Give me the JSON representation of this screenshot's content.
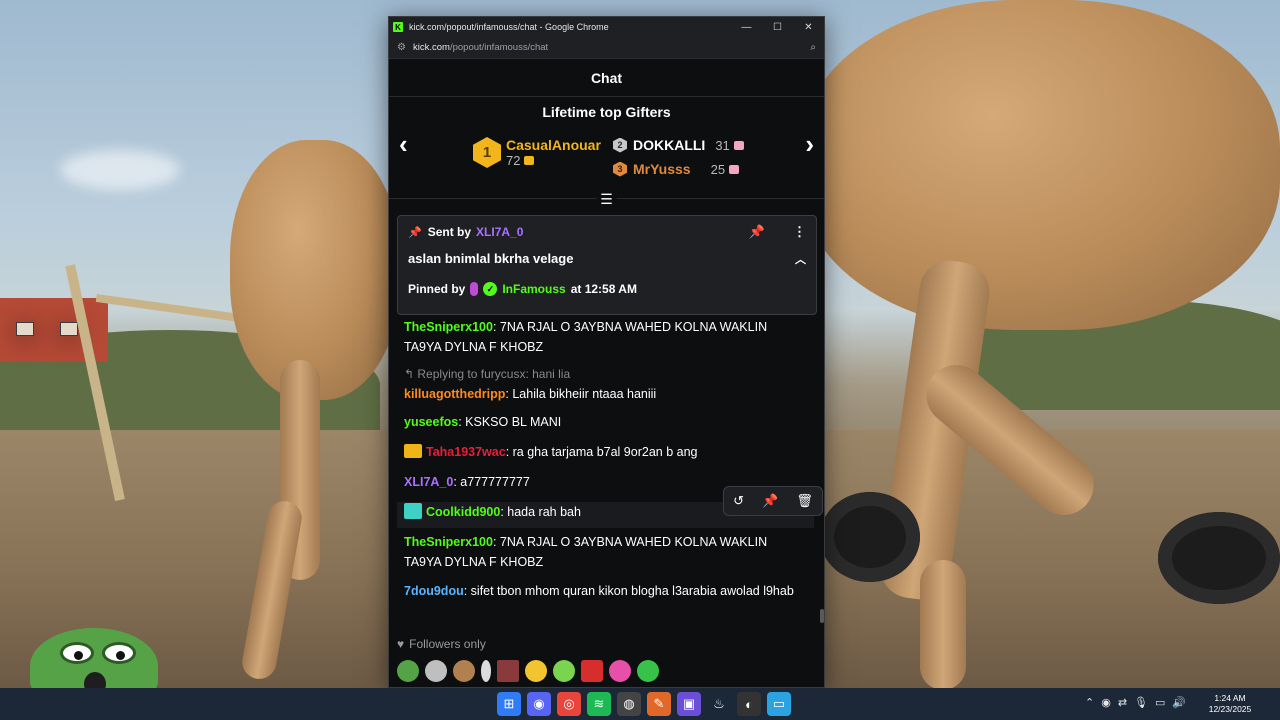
{
  "window": {
    "title": "kick.com/popout/infamouss/chat - Google Chrome",
    "address_host": "kick.com",
    "address_path": "/popout/infamouss/chat",
    "logo_letter": "K"
  },
  "chat": {
    "header": "Chat",
    "gifters_title": "Lifetime top Gifters",
    "gifters": [
      {
        "rank": "1",
        "name": "CasualAnouar",
        "count": "72",
        "name_color": "#f2b51b"
      },
      {
        "rank": "2",
        "name": "DOKKALLI",
        "count": "31",
        "name_color": "#ffffff"
      },
      {
        "rank": "3",
        "name": "MrYusss",
        "count": "25",
        "name_color": "#e08a3c"
      }
    ],
    "pinned": {
      "sent_by_label": "Sent by",
      "sender": "XLI7A_0",
      "message": "aslan bnimlal bkrha velage",
      "pinned_by_label": "Pinned by",
      "pinned_by": "InFamouss",
      "time": "at 12:58 AM"
    },
    "messages": [
      {
        "user": "TheSniperx100",
        "color": "#53fc18",
        "text": ": 7NA RJAL O 3AYBNA WAHED KOLNA WAKLIN TA9YA DYLNA F KHOBZ"
      },
      {
        "reply": "Replying to furycusx: hani lia",
        "user": "killuagotthedripp",
        "color": "#ff8a1c",
        "text": ": Lahila bikheiir ntaaa haniii"
      },
      {
        "user": "yuseefos",
        "color": "#53fc18",
        "text": ": KSKSO BL MANI"
      },
      {
        "user": "Taha1937wac",
        "color": "#e5203a",
        "text": ": ra gha tarjama b7al 9or2an b ang"
      },
      {
        "user": "XLI7A_0",
        "color": "#a970ff",
        "text": ": a777777777"
      },
      {
        "user": "Coolkidd900",
        "color": "#53fc18",
        "text": ": hada rah bah"
      },
      {
        "user": "TheSniperx100",
        "color": "#53fc18",
        "text": ": 7NA RJAL O 3AYBNA WAHED KOLNA WAKLIN TA9YA DYLNA F KHOBZ"
      },
      {
        "user": "7dou9dou",
        "color": "#5ab4ff",
        "text": ": sifet tbon mhom quran kikon blogha l3arabia awolad l9hab"
      }
    ],
    "followers_only": "Followers only",
    "emotes": [
      "pepe-emote",
      "skull-emote",
      "camel-emote",
      "mic-emote",
      "brick-emote",
      "sad-emote",
      "halo-emote",
      "red-face-emote",
      "clown-emote",
      "green-face-emote"
    ]
  },
  "taskbar": {
    "time": "1:24 AM",
    "date": "12/23/2025"
  }
}
